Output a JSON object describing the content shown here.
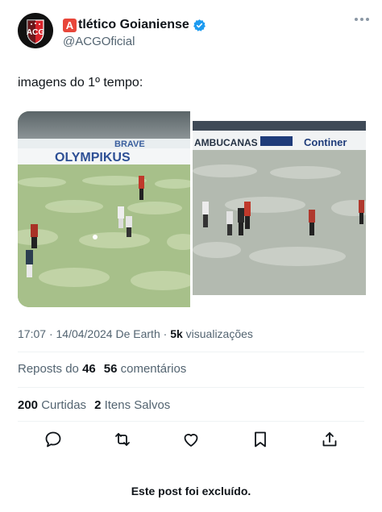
{
  "author": {
    "name_emoji": "A",
    "name": "tlético Goianiense",
    "handle": "@ACGOficial"
  },
  "tweet": {
    "text": "imagens do 1º tempo:"
  },
  "meta": {
    "time": "17:07",
    "date": "14/04/2024",
    "source_prefix": "De",
    "source": "Earth",
    "views_count": "5k",
    "views_label": "visualizações"
  },
  "stats": {
    "reposts_label": "Reposts do",
    "reposts_count": "46",
    "comments_count": "56",
    "comments_label": "comentários",
    "likes_count": "200",
    "likes_label": "Curtidas",
    "saves_count": "2",
    "saves_label": "Itens Salvos"
  },
  "media": {
    "photo1_banner": "OLYMPIKUS",
    "photo1_banner_top": "BRAVE",
    "photo2_banner_left": "AMBUCANAS",
    "photo2_banner_right": "Continer"
  },
  "icons": {
    "reply": "reply-icon",
    "repost": "repost-icon",
    "like": "heart-icon",
    "bookmark": "bookmark-icon",
    "share": "share-icon"
  },
  "footer": {
    "deleted_notice": "Este post foi excluído."
  },
  "colors": {
    "verified": "#1d9bf0",
    "secondary_text": "#536471",
    "primary_text": "#0f1419"
  }
}
